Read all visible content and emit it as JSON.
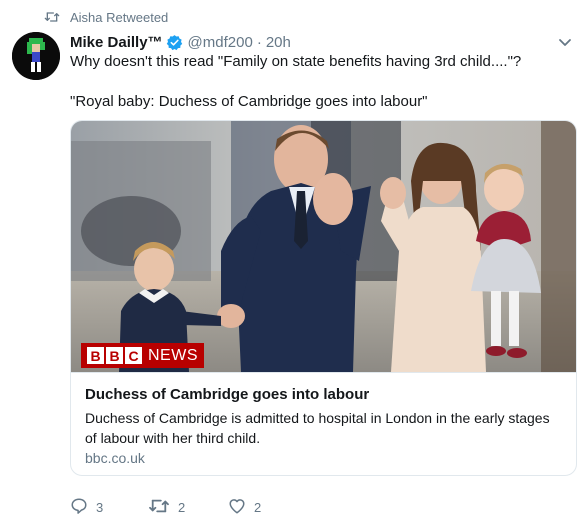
{
  "retweet": {
    "text": "Aisha Retweeted",
    "icon": "retweet-icon"
  },
  "tweet": {
    "author_name": "Mike Dailly™",
    "handle": "@mdf200",
    "separator": "·",
    "time": "20h",
    "text_line1": "Why doesn't this read \"Family on state benefits having 3rd child....\"?",
    "text_line2": "\"Royal baby: Duchess of Cambridge goes into labour\""
  },
  "card": {
    "logo_box1": "B",
    "logo_box2": "B",
    "logo_box3": "C",
    "logo_news": "NEWS",
    "title": "Duchess of Cambridge goes into labour",
    "description": "Duchess of Cambridge is admitted to hospital in London in the early stages of labour with her third child.",
    "domain": "bbc.co.uk"
  },
  "actions": {
    "reply_count": "3",
    "retweet_count": "2",
    "like_count": "2"
  },
  "colors": {
    "verified": "#1da1f2",
    "secondary_text": "#657786",
    "bbc_red": "#b80000",
    "border": "#e1e8ed"
  },
  "icons": [
    "retweet-icon",
    "verified-badge-icon",
    "chevron-down-icon",
    "reply-icon",
    "retweet-action-icon",
    "like-icon"
  ]
}
